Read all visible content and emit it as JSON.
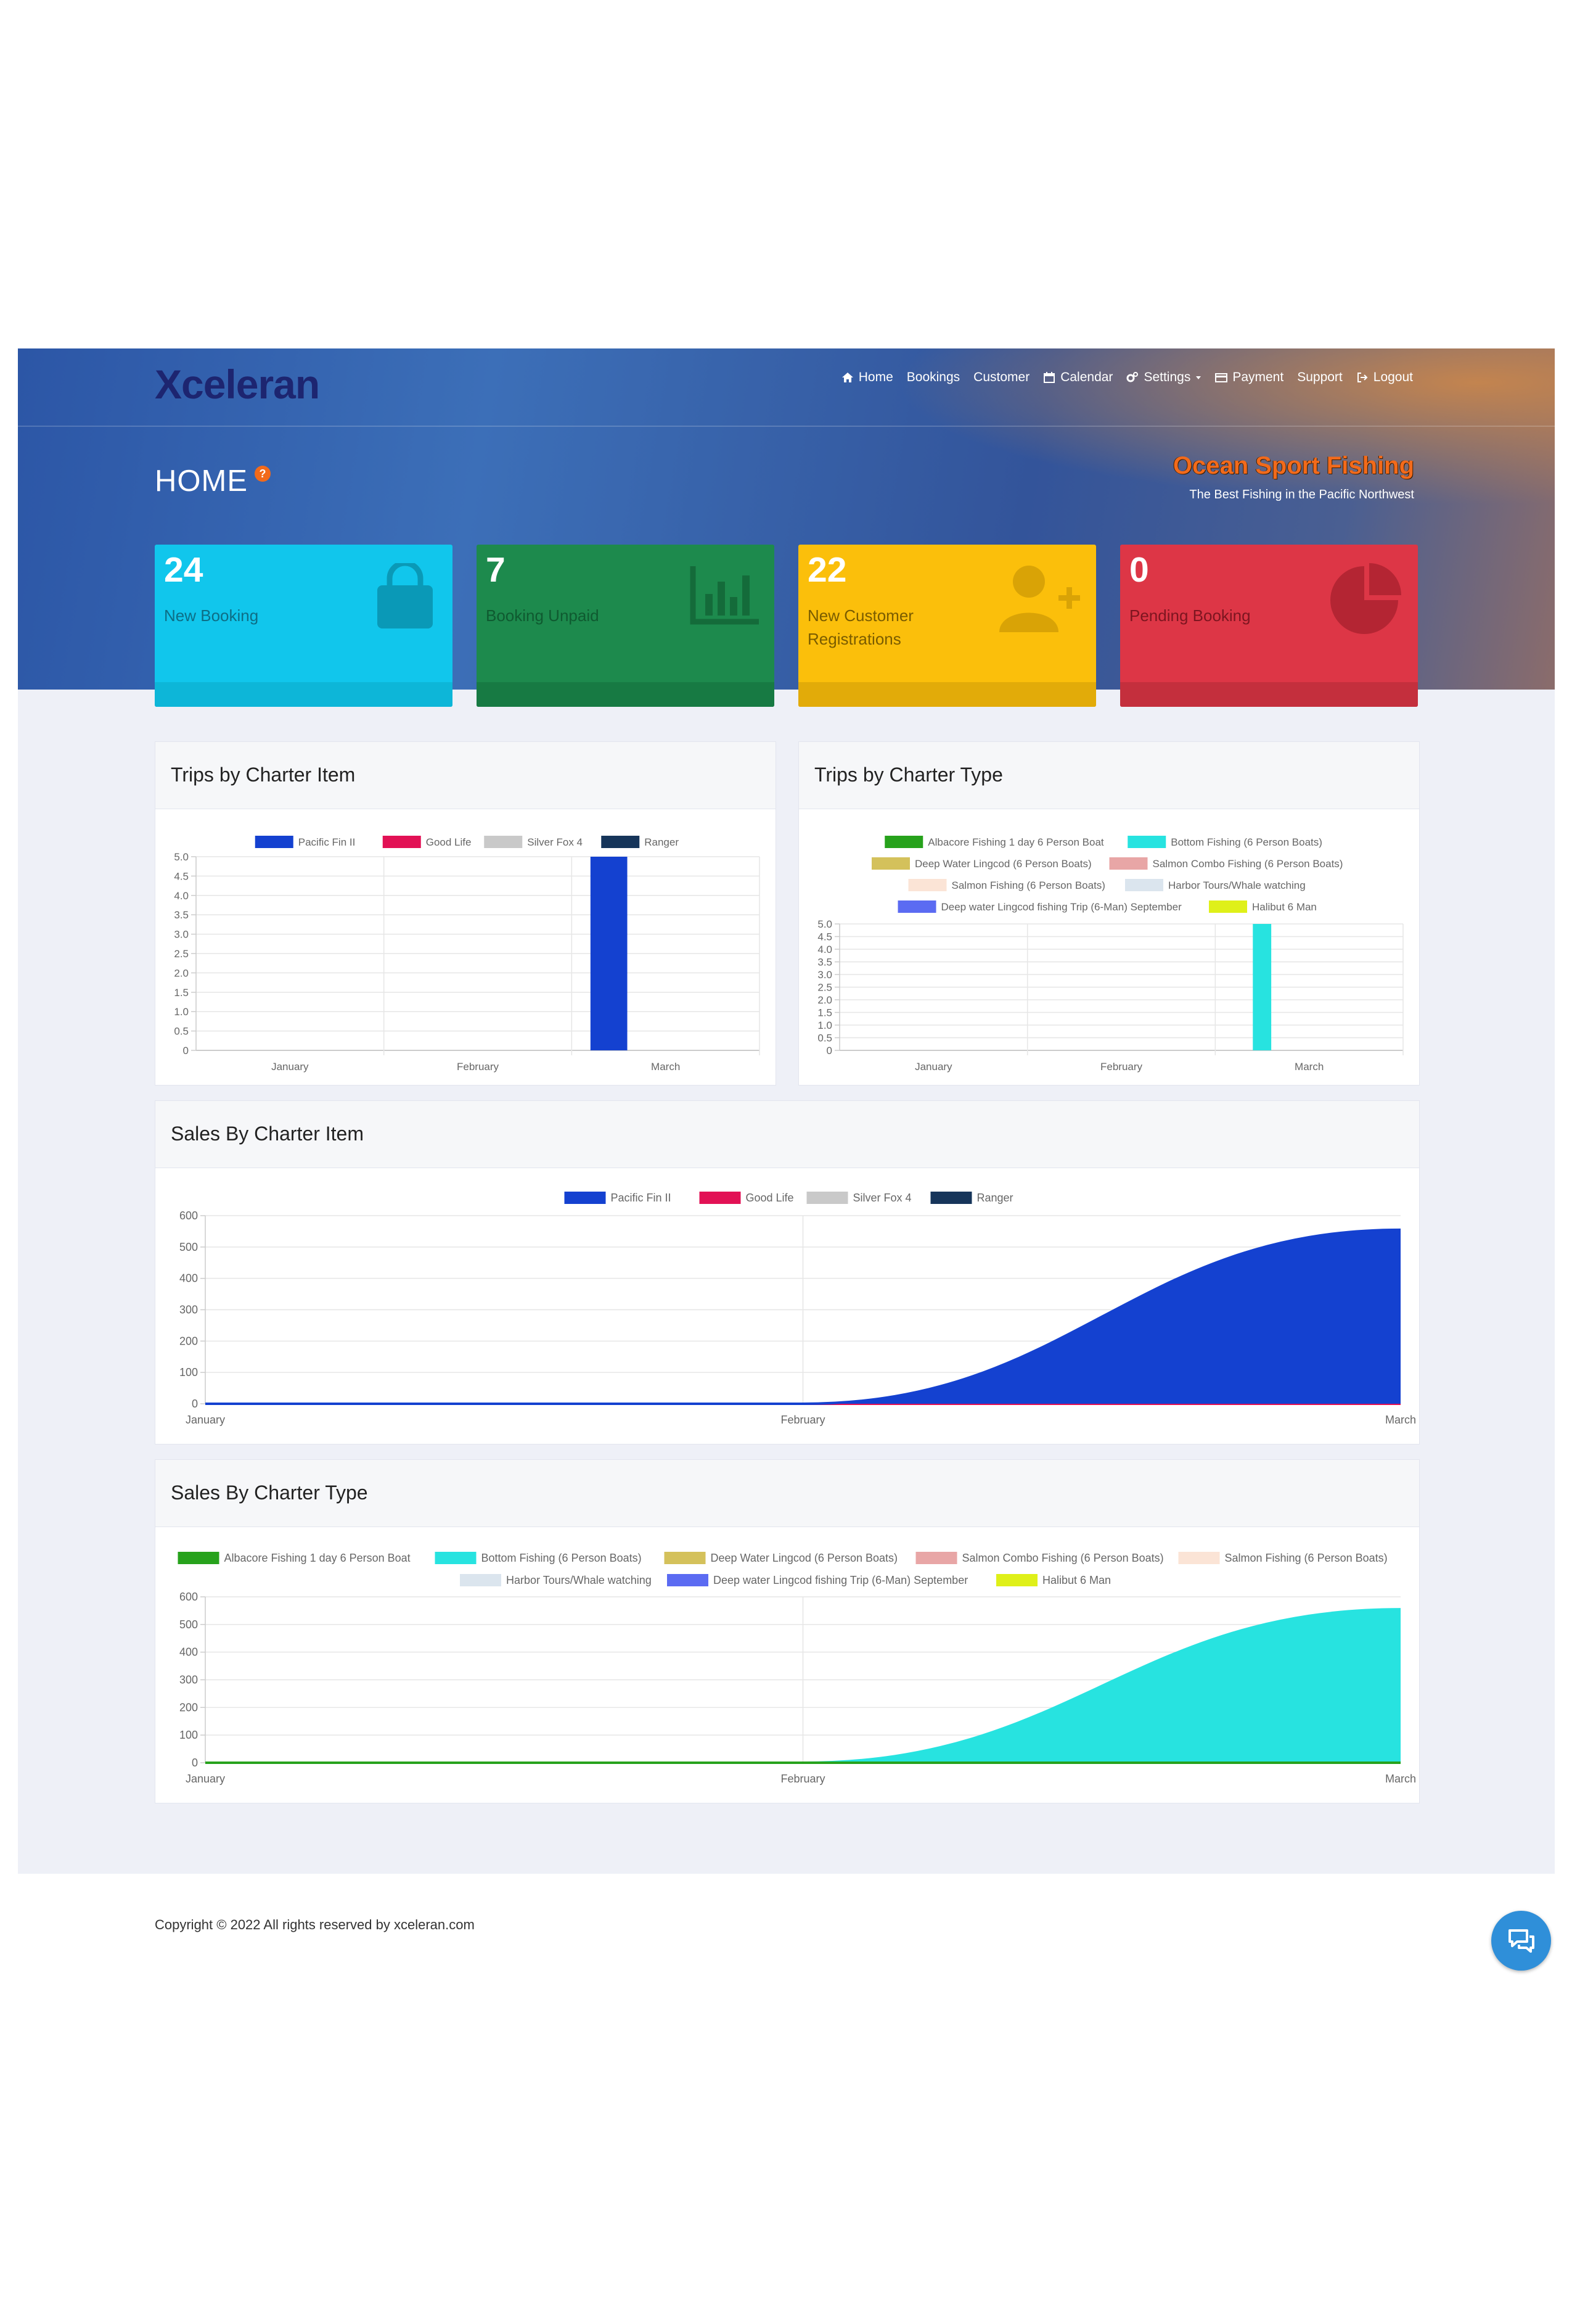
{
  "header": {
    "logo": "Xceleran",
    "nav": [
      "Home",
      "Bookings",
      "Customer",
      "Calendar",
      "Settings",
      "Payment",
      "Support",
      "Logout"
    ],
    "page_title": "HOME",
    "help_badge": "?",
    "brand_title": "Ocean Sport Fishing",
    "brand_subtitle": "The Best Fishing in the Pacific Northwest"
  },
  "stats": [
    {
      "value": "24",
      "label": "New Booking",
      "color": "#11c6ec",
      "bar": "#0db6d8",
      "icon": "shopping-bag-icon"
    },
    {
      "value": "7",
      "label": "Booking Unpaid",
      "color": "#1d8a4d",
      "bar": "#177a43",
      "icon": "bar-chart-icon"
    },
    {
      "value": "22",
      "label": "New Customer Registrations",
      "color": "#fbbf0b",
      "bar": "#e2ab09",
      "icon": "user-plus-icon"
    },
    {
      "value": "0",
      "label": "Pending Booking",
      "color": "#dd3646",
      "bar": "#c42f3d",
      "icon": "pie-chart-icon"
    }
  ],
  "cards": {
    "trips_item": "Trips by Charter Item",
    "trips_type": "Trips by Charter Type",
    "sales_item": "Sales By Charter Item",
    "sales_type": "Sales By Charter Type"
  },
  "colors": {
    "Pacific Fin II": "#1441d0",
    "Good Life": "#e21155",
    "Silver Fox 4": "#c9c9c9",
    "Ranger": "#16355a",
    "Albacore Fishing 1 day 6 Person Boat": "#27a21c",
    "Bottom Fishing (6 Person Boats)": "#27e3e0",
    "Deep Water Lingcod (6 Person Boats)": "#d4c15b",
    "Salmon Combo Fishing (6 Person Boats)": "#e8a6a6",
    "Salmon Fishing (6 Person Boats)": "#fbe4d6",
    "Harbor Tours/Whale watching": "#dbe5ee",
    "Deep water Lingcod fishing Trip (6-Man) September": "#5b6bf2",
    "Halibut 6 Man": "#dff019"
  },
  "chart_data": [
    {
      "type": "bar",
      "title": "Trips by Charter Item",
      "categories": [
        "January",
        "February",
        "March"
      ],
      "yticks": [
        "5.0",
        "4.5",
        "4.0",
        "3.5",
        "3.0",
        "2.5",
        "2.0",
        "1.5",
        "1.0",
        "0.5",
        "0"
      ],
      "ylim": [
        0,
        5
      ],
      "series": [
        {
          "name": "Pacific Fin II",
          "values": [
            0,
            0,
            5
          ]
        },
        {
          "name": "Good Life",
          "values": [
            0,
            0,
            0
          ]
        },
        {
          "name": "Silver Fox 4",
          "values": [
            0,
            0,
            0
          ]
        },
        {
          "name": "Ranger",
          "values": [
            0,
            0,
            0
          ]
        }
      ]
    },
    {
      "type": "bar",
      "title": "Trips by Charter Type",
      "categories": [
        "January",
        "February",
        "March"
      ],
      "yticks": [
        "5.0",
        "4.5",
        "4.0",
        "3.5",
        "3.0",
        "2.5",
        "2.0",
        "1.5",
        "1.0",
        "0.5",
        "0"
      ],
      "ylim": [
        0,
        5
      ],
      "series": [
        {
          "name": "Albacore Fishing 1 day 6 Person Boat",
          "values": [
            0,
            0,
            0
          ]
        },
        {
          "name": "Bottom Fishing (6 Person Boats)",
          "values": [
            0,
            0,
            5
          ]
        },
        {
          "name": "Deep Water Lingcod (6 Person Boats)",
          "values": [
            0,
            0,
            0
          ]
        },
        {
          "name": "Salmon Combo Fishing (6 Person Boats)",
          "values": [
            0,
            0,
            0
          ]
        },
        {
          "name": "Salmon Fishing (6 Person Boats)",
          "values": [
            0,
            0,
            0
          ]
        },
        {
          "name": "Harbor Tours/Whale watching",
          "values": [
            0,
            0,
            0
          ]
        },
        {
          "name": "Deep water Lingcod fishing Trip (6-Man) September",
          "values": [
            0,
            0,
            0
          ]
        },
        {
          "name": "Halibut 6 Man",
          "values": [
            0,
            0,
            0
          ]
        }
      ]
    },
    {
      "type": "area",
      "title": "Sales By Charter Item",
      "categories": [
        "January",
        "February",
        "March"
      ],
      "yticks": [
        "600",
        "500",
        "400",
        "300",
        "200",
        "100",
        "0"
      ],
      "ylim": [
        0,
        600
      ],
      "series": [
        {
          "name": "Pacific Fin II",
          "values": [
            0,
            0,
            555
          ]
        },
        {
          "name": "Good Life",
          "values": [
            0,
            0,
            0
          ]
        },
        {
          "name": "Silver Fox 4",
          "values": [
            0,
            0,
            0
          ]
        },
        {
          "name": "Ranger",
          "values": [
            0,
            0,
            0
          ]
        }
      ]
    },
    {
      "type": "area",
      "title": "Sales By Charter Type",
      "categories": [
        "January",
        "February",
        "March"
      ],
      "yticks": [
        "600",
        "500",
        "400",
        "300",
        "200",
        "100",
        "0"
      ],
      "ylim": [
        0,
        600
      ],
      "series": [
        {
          "name": "Albacore Fishing 1 day 6 Person Boat",
          "values": [
            0,
            0,
            0
          ]
        },
        {
          "name": "Bottom Fishing (6 Person Boats)",
          "values": [
            0,
            0,
            555
          ]
        },
        {
          "name": "Deep Water Lingcod (6 Person Boats)",
          "values": [
            0,
            0,
            0
          ]
        },
        {
          "name": "Salmon Combo Fishing (6 Person Boats)",
          "values": [
            0,
            0,
            0
          ]
        },
        {
          "name": "Salmon Fishing (6 Person Boats)",
          "values": [
            0,
            0,
            0
          ]
        },
        {
          "name": "Harbor Tours/Whale watching",
          "values": [
            0,
            0,
            0
          ]
        },
        {
          "name": "Deep water Lingcod fishing Trip (6-Man) September",
          "values": [
            0,
            0,
            0
          ]
        },
        {
          "name": "Halibut 6 Man",
          "values": [
            0,
            0,
            0
          ]
        }
      ]
    }
  ],
  "footer": "Copyright © 2022 All rights reserved by xceleran.com"
}
